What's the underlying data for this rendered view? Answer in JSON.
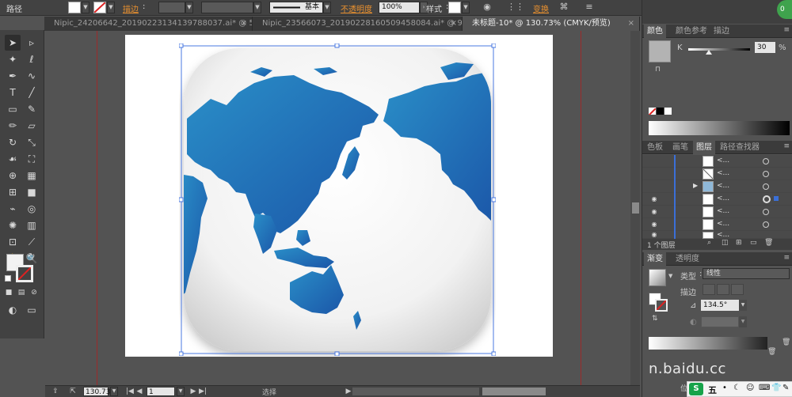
{
  "control_bar": {
    "object_type": "路径",
    "stroke_label": "描边",
    "stroke_profile_value": "基本",
    "opacity_label": "不透明度",
    "opacity_value": "100%",
    "style_label": "样式",
    "transform_label": "变换"
  },
  "tabs": [
    {
      "label": "Nipic_24206642_20190223134139788037.ai* @ 50...",
      "active": false
    },
    {
      "label": "Nipic_23566073_20190228160509458084.ai* @ 98...",
      "active": false
    },
    {
      "label": "未标题-10* @ 130.73% (CMYK/预览)",
      "active": true
    }
  ],
  "status_bar": {
    "zoom_value": "130.73",
    "page_value": "1",
    "tool_label": "选择"
  },
  "color_panel": {
    "tabs": [
      "颜色",
      "颜色参考",
      "描边"
    ],
    "channel_label": "K",
    "channel_value": "30",
    "channel_unit": "%"
  },
  "layers_panel": {
    "tabs": [
      "色板",
      "画笔",
      "图层",
      "路径查找器"
    ],
    "footer_label": "1 个图层",
    "rows": [
      {
        "name": "<...",
        "visible": false
      },
      {
        "name": "<...",
        "visible": false
      },
      {
        "name": "<...",
        "visible": false
      },
      {
        "name": "<...",
        "visible": true
      },
      {
        "name": "<...",
        "visible": true
      },
      {
        "name": "<...",
        "visible": true
      },
      {
        "name": "<...",
        "visible": true
      }
    ]
  },
  "gradient_panel": {
    "tabs": [
      "渐变",
      "透明度"
    ],
    "type_label": "类型",
    "type_value": "线性",
    "stroke_label": "描边",
    "angle_value": "134.5°",
    "location_label": "位"
  },
  "watermark": {
    "text": "n.baidu.cc"
  },
  "taskbar": {
    "ime_label": "五"
  },
  "colors": {
    "map_blue_light": "#2a8fc8",
    "map_blue_dark": "#1b56a8",
    "accent_orange": "#e8902f",
    "selection_blue": "#4a78e0"
  }
}
